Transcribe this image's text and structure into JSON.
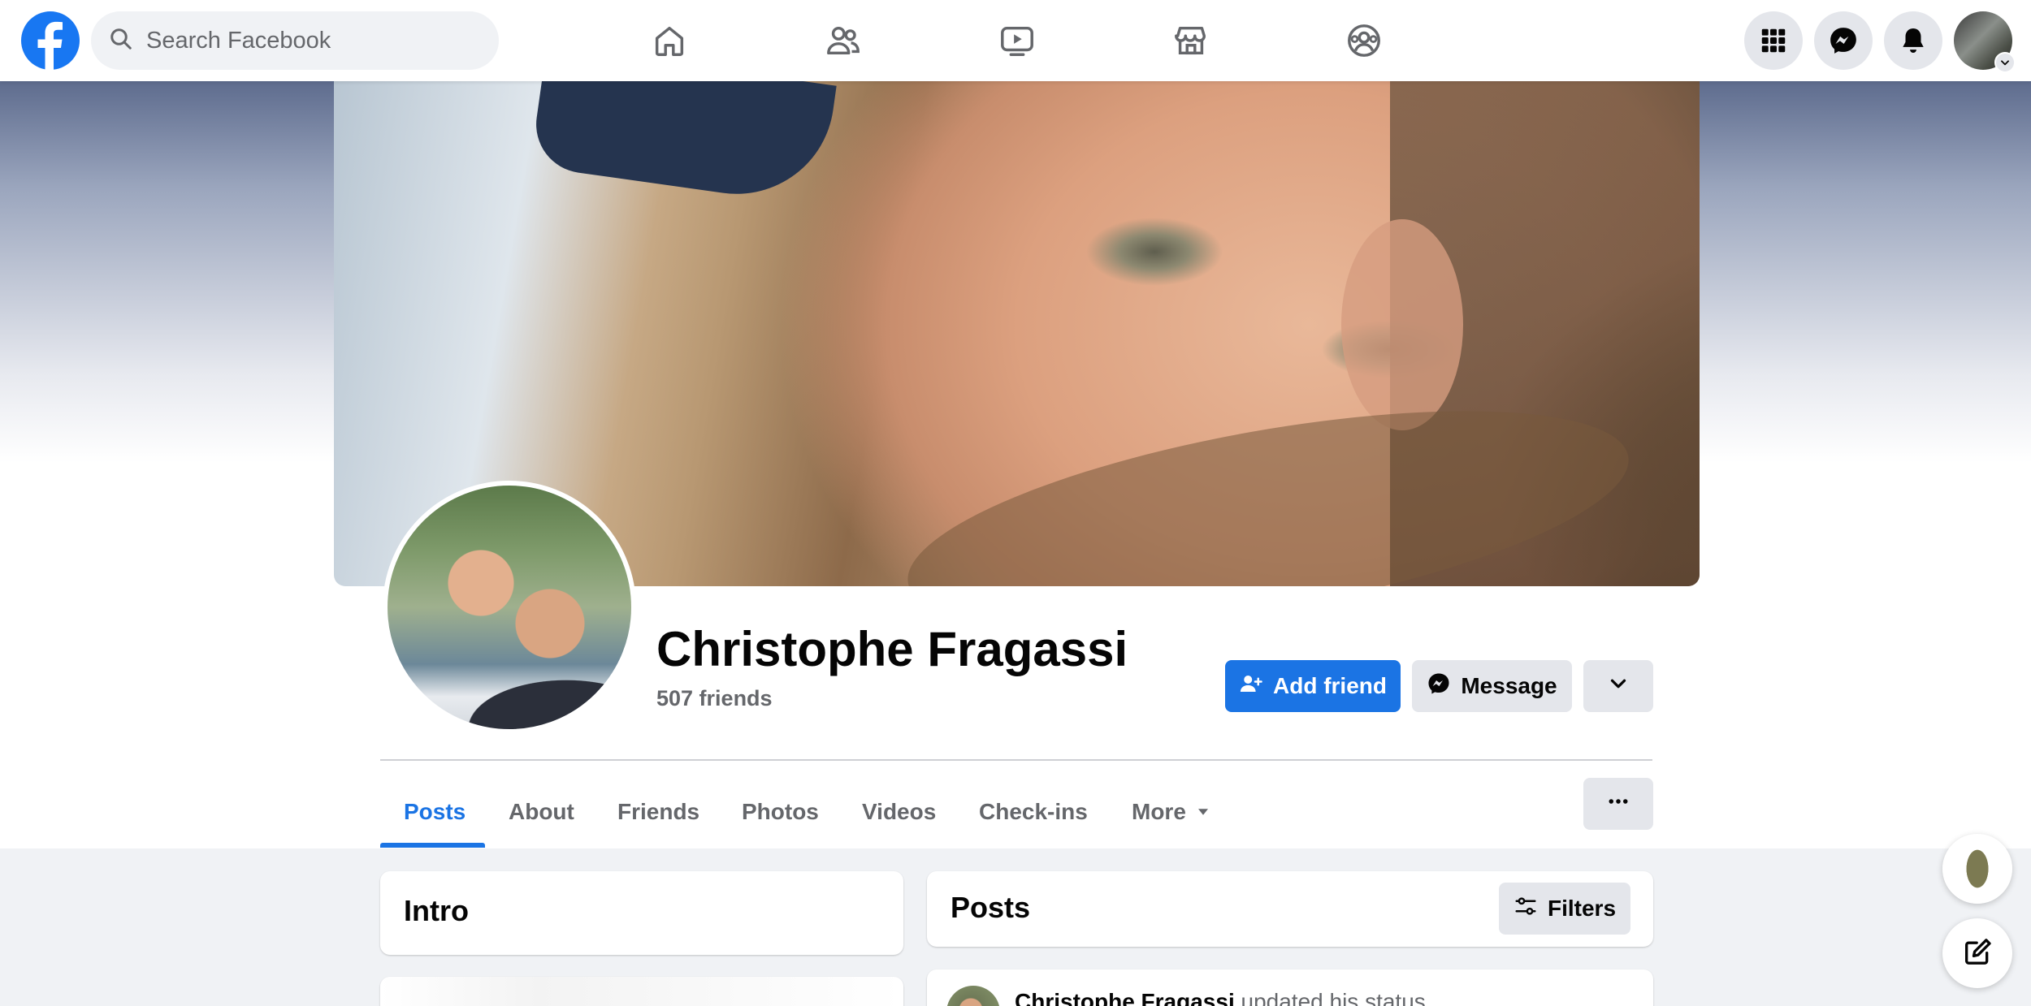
{
  "topbar": {
    "search_placeholder": "Search Facebook",
    "nav_icons": [
      "home-icon",
      "friends-icon",
      "watch-icon",
      "marketplace-icon",
      "groups-icon"
    ],
    "right_icons": [
      "menu-grid-icon",
      "messenger-icon",
      "notifications-icon",
      "account-avatar"
    ]
  },
  "profile": {
    "name": "Christophe Fragassi",
    "friends": "507 friends",
    "actions": {
      "add_friend": "Add friend",
      "message": "Message"
    }
  },
  "tabs": [
    {
      "label": "Posts",
      "active": true
    },
    {
      "label": "About"
    },
    {
      "label": "Friends"
    },
    {
      "label": "Photos"
    },
    {
      "label": "Videos"
    },
    {
      "label": "Check-ins"
    },
    {
      "label": "More"
    }
  ],
  "intro": {
    "title": "Intro"
  },
  "posts": {
    "title": "Posts",
    "filters_label": "Filters",
    "first_post": {
      "author": "Christophe Fragassi",
      "action": "updated his status."
    }
  },
  "colors": {
    "brand_blue": "#1877f2",
    "button_blue": "#1b74e4",
    "secondary_gray": "#e4e6eb",
    "page_bg": "#f0f2f5"
  }
}
